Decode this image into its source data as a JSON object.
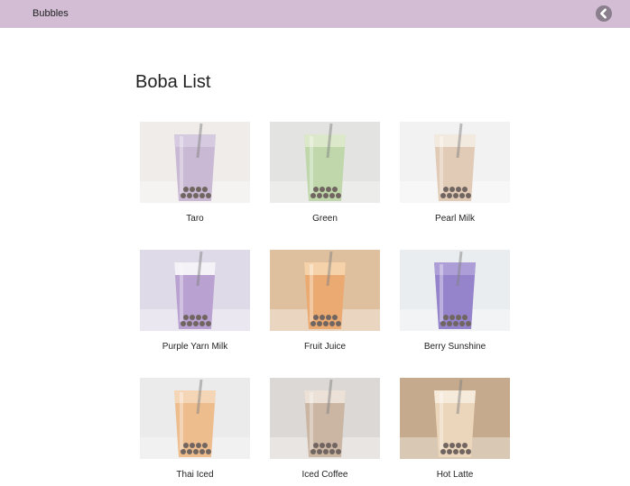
{
  "app": {
    "title": "Bubbles"
  },
  "header": {
    "back_icon": "chevron-left-icon"
  },
  "page": {
    "title": "Boba List"
  },
  "items": [
    {
      "label": "Taro",
      "colors": {
        "bg": "#e9e6e2",
        "drink": "#b59fc4",
        "foam": "#c7b6d5"
      }
    },
    {
      "label": "Green",
      "colors": {
        "bg": "#d9d9d6",
        "drink": "#a7c98b",
        "foam": "#cfe0b7"
      }
    },
    {
      "label": "Pearl Milk",
      "colors": {
        "bg": "#eeeeee",
        "drink": "#d8b89a",
        "foam": "#efe3d4"
      }
    },
    {
      "label": "Purple Yarn Milk",
      "colors": {
        "bg": "#d4cde0",
        "drink": "#9f7fc0",
        "foam": "#f1ecf4"
      }
    },
    {
      "label": "Fruit Juice",
      "colors": {
        "bg": "#d3a87a",
        "drink": "#e58a3e",
        "foam": "#f2c28a"
      }
    },
    {
      "label": "Berry Sunshine",
      "colors": {
        "bg": "#e3e7ea",
        "drink": "#6d56b8",
        "foam": "#8f7ac9"
      }
    },
    {
      "label": "Thai Iced",
      "colors": {
        "bg": "#e4e4e4",
        "drink": "#e8a564",
        "foam": "#f1c79b"
      }
    },
    {
      "label": "Iced Coffee",
      "colors": {
        "bg": "#cfcac5",
        "drink": "#b89b80",
        "foam": "#e4d6c7"
      }
    },
    {
      "label": "Hot Latte",
      "colors": {
        "bg": "#b08a62",
        "drink": "#e5c7a1",
        "foam": "#f3e3cd"
      }
    }
  ]
}
